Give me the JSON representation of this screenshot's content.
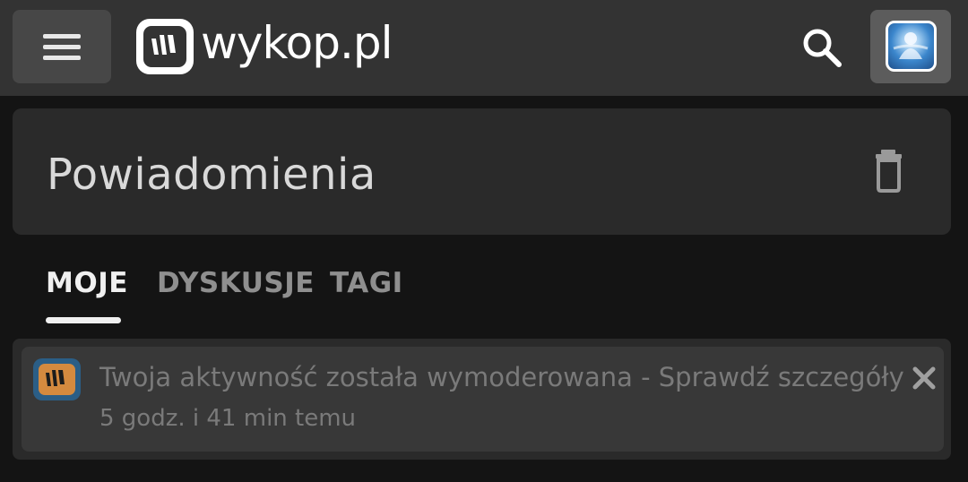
{
  "header": {
    "logo_text": "wykop.pl",
    "menu_icon": "hamburger-menu-icon",
    "search_icon": "search-icon",
    "avatar_icon": "user-avatar"
  },
  "page": {
    "title": "Powiadomienia",
    "trash_icon": "trash-icon"
  },
  "tabs": [
    {
      "label": "MOJE",
      "active": true
    },
    {
      "label": "DYSKUSJE",
      "active": false
    },
    {
      "label": "TAGI",
      "active": false
    }
  ],
  "notifications": [
    {
      "text": "Twoja aktywność została wymoderowana - Sprawdź szczegóły",
      "time": "5 godz. i 41 min temu",
      "icon": "wykop-logo-icon",
      "close_icon": "close-icon"
    }
  ],
  "colors": {
    "topbar": "#333333",
    "background": "#141414",
    "card": "#2a2a2a",
    "notification": "#383838",
    "active_tab": "#f0f0f0",
    "inactive_tab": "#8f8f8f",
    "notification_text": "#7a7a7a"
  }
}
